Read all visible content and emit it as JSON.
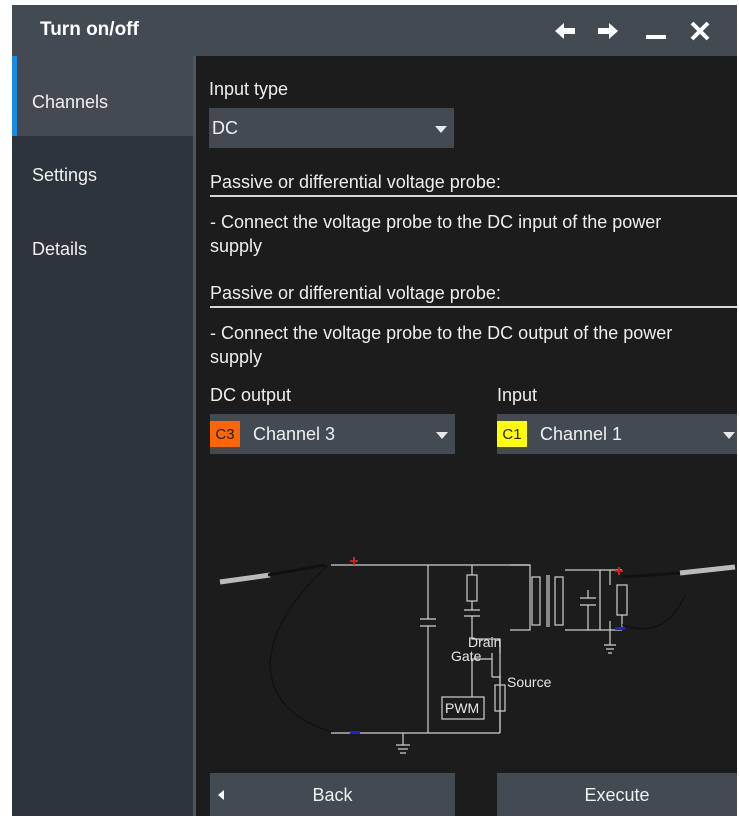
{
  "window": {
    "title": "Turn on/off",
    "icons": [
      "arrow-left-icon",
      "arrow-right-icon",
      "minimize-icon",
      "close-icon"
    ]
  },
  "sidebar": {
    "items": [
      {
        "label": "Channels",
        "active": true
      },
      {
        "label": "Settings",
        "active": false
      },
      {
        "label": "Details",
        "active": false
      }
    ]
  },
  "main": {
    "input_type_label": "Input type",
    "input_type_value": "DC",
    "section1_heading": "Passive or differential voltage probe:",
    "section1_text": "- Connect the voltage probe to the DC input of the power supply",
    "section2_heading": "Passive or differential voltage probe:",
    "section2_text": "- Connect the voltage probe to the DC output of the power supply",
    "dc_output_label": "DC output",
    "dc_output_badge": "C3",
    "dc_output_value": "Channel 3",
    "input_label": "Input",
    "input_badge": "C1",
    "input_value": "Channel 1"
  },
  "diagram": {
    "labels": {
      "drain": "Drain",
      "gate": "Gate",
      "source": "Source",
      "pwm": "PWM"
    }
  },
  "buttons": {
    "back": "Back",
    "execute": "Execute"
  },
  "colors": {
    "channel3": "#ff6600",
    "channel1": "#ffff00",
    "accent": "#1a8ce0",
    "plus_marker": "#cc2222",
    "minus_marker": "#2222cc"
  }
}
